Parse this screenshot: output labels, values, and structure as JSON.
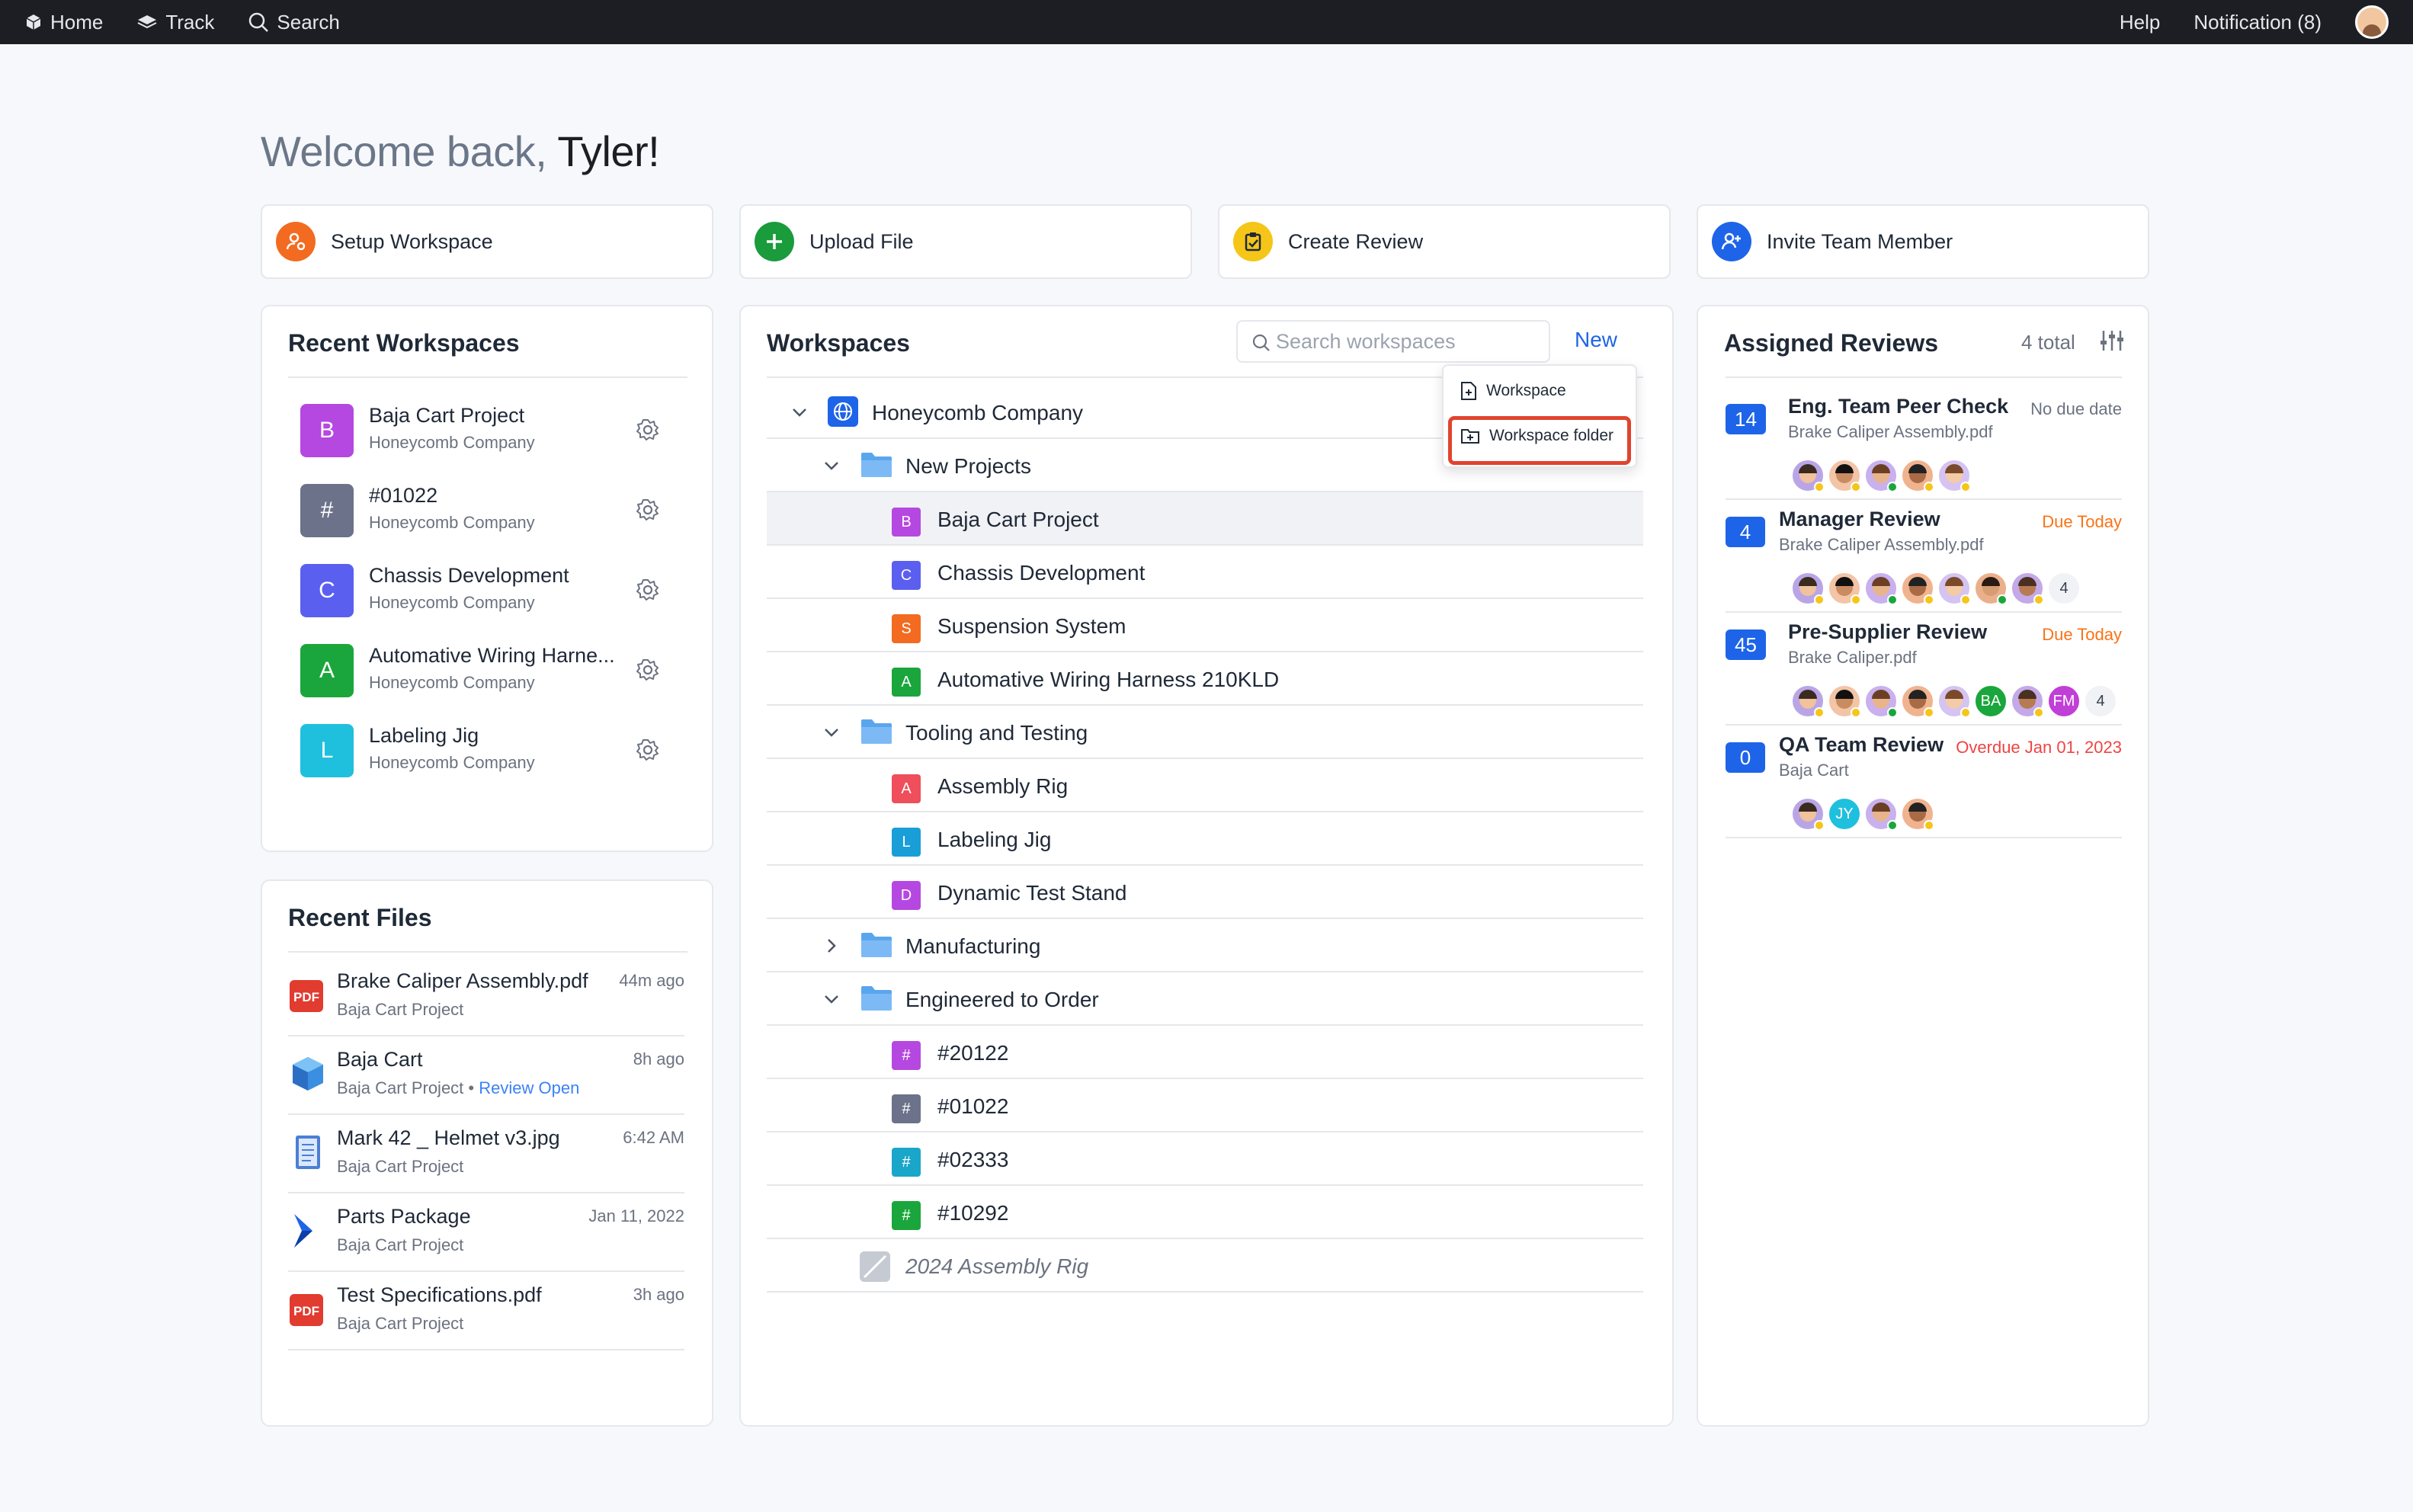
{
  "topbar": {
    "home": "Home",
    "track": "Track",
    "search": "Search",
    "help": "Help",
    "notification": "Notification (8)"
  },
  "welcome": {
    "greeting": "Welcome back,",
    "name": "Tyler!"
  },
  "quick_actions": [
    {
      "label": "Setup Workspace",
      "icon": "user-gear-icon",
      "color": "#f26b21"
    },
    {
      "label": "Upload File",
      "icon": "plus-icon",
      "color": "#1a9b3c"
    },
    {
      "label": "Create Review",
      "icon": "clipboard-check-icon",
      "color": "#f5c518"
    },
    {
      "label": "Invite Team Member",
      "icon": "user-plus-icon",
      "color": "#1e64e8"
    }
  ],
  "recent_workspaces": {
    "title": "Recent Workspaces",
    "items": [
      {
        "badge": "B",
        "name": "Baja Cart Project",
        "company": "Honeycomb Company",
        "color": "#b548e0"
      },
      {
        "badge": "#",
        "name": "#01022",
        "company": "Honeycomb Company",
        "color": "#6b7289"
      },
      {
        "badge": "C",
        "name": "Chassis Development",
        "company": "Honeycomb Company",
        "color": "#5b5ff0"
      },
      {
        "badge": "A",
        "name": "Automative Wiring Harne...",
        "company": "Honeycomb Company",
        "color": "#1aa63c"
      },
      {
        "badge": "L",
        "name": "Labeling Jig",
        "company": "Honeycomb Company",
        "color": "#1fc0dd"
      }
    ]
  },
  "recent_files": {
    "title": "Recent Files",
    "items": [
      {
        "name": "Brake Caliper Assembly.pdf",
        "project": "Baja Cart Project",
        "time": "44m ago",
        "icon": "pdf-icon",
        "link": ""
      },
      {
        "name": "Baja Cart",
        "project": "Baja Cart Project",
        "time": "8h ago",
        "icon": "cube-icon",
        "link": "Review Open"
      },
      {
        "name": "Mark 42 _ Helmet v3.jpg",
        "project": "Baja Cart Project",
        "time": "6:42 AM",
        "icon": "document-icon",
        "link": ""
      },
      {
        "name": "Parts Package",
        "project": "Baja Cart Project",
        "time": "Jan 11, 2022",
        "icon": "chevron-logo-icon",
        "link": ""
      },
      {
        "name": "Test Specifications.pdf",
        "project": "Baja Cart Project",
        "time": "3h ago",
        "icon": "pdf-icon",
        "link": ""
      }
    ]
  },
  "workspaces": {
    "title": "Workspaces",
    "search_placeholder": "Search workspaces",
    "new_label": "New",
    "dropdown": [
      "Workspace",
      "Workspace folder"
    ],
    "tree": [
      {
        "label": "Honeycomb Company",
        "type": "root",
        "level": 0,
        "expanded": true
      },
      {
        "label": "New Projects",
        "type": "folder",
        "level": 1,
        "expanded": true
      },
      {
        "label": "Baja Cart Project",
        "type": "ws",
        "level": 2,
        "badge": "B",
        "color": "#b548e0",
        "selected": true
      },
      {
        "label": "Chassis Development",
        "type": "ws",
        "level": 2,
        "badge": "C",
        "color": "#5b5ff0"
      },
      {
        "label": "Suspension System",
        "type": "ws",
        "level": 2,
        "badge": "S",
        "color": "#f26b21"
      },
      {
        "label": "Automative Wiring Harness 210KLD",
        "type": "ws",
        "level": 2,
        "badge": "A",
        "color": "#1aa63c"
      },
      {
        "label": "Tooling and Testing",
        "type": "folder",
        "level": 1,
        "expanded": true
      },
      {
        "label": "Assembly Rig",
        "type": "ws",
        "level": 2,
        "badge": "A",
        "color": "#ef4e5b"
      },
      {
        "label": "Labeling Jig",
        "type": "ws",
        "level": 2,
        "badge": "L",
        "color": "#1a9ed8"
      },
      {
        "label": "Dynamic Test Stand",
        "type": "ws",
        "level": 2,
        "badge": "D",
        "color": "#b548e0"
      },
      {
        "label": "Manufacturing",
        "type": "folder",
        "level": 1,
        "expanded": false
      },
      {
        "label": "Engineered to Order",
        "type": "folder",
        "level": 1,
        "expanded": true
      },
      {
        "label": "#20122",
        "type": "ws",
        "level": 2,
        "badge": "#",
        "color": "#b548e0"
      },
      {
        "label": "#01022",
        "type": "ws",
        "level": 2,
        "badge": "#",
        "color": "#6b7289"
      },
      {
        "label": "#02333",
        "type": "ws",
        "level": 2,
        "badge": "#",
        "color": "#1aa6c8"
      },
      {
        "label": "#10292",
        "type": "ws",
        "level": 2,
        "badge": "#",
        "color": "#1aa63c"
      },
      {
        "label": "2024 Assembly Rig",
        "type": "archived",
        "level": 1
      }
    ]
  },
  "assigned_reviews": {
    "title": "Assigned Reviews",
    "total": "4 total",
    "items": [
      {
        "count": "14",
        "name": "Eng. Team Peer Check",
        "file": "Brake Caliper Assembly.pdf",
        "due": "No due date",
        "due_color": "#6b7280",
        "avatars": [
          "p",
          "p",
          "p",
          "p",
          "p"
        ],
        "extra": ""
      },
      {
        "count": "4",
        "name": "Manager Review",
        "file": "Brake Caliper Assembly.pdf",
        "due": "Due Today",
        "due_color": "#f97316",
        "avatars": [
          "p",
          "p",
          "p",
          "p",
          "p",
          "p",
          "p"
        ],
        "extra": "4"
      },
      {
        "count": "45",
        "name": "Pre-Supplier Review",
        "file": "Brake Caliper.pdf",
        "due": "Due Today",
        "due_color": "#f97316",
        "avatars": [
          "p",
          "p",
          "p",
          "p",
          "p",
          "BA",
          "p",
          "FM"
        ],
        "extra": "4"
      },
      {
        "count": "0",
        "name": "QA Team Review",
        "file": "Baja Cart",
        "due": "Overdue Jan 01, 2023",
        "due_color": "#ef4444",
        "avatars": [
          "p",
          "JY",
          "p",
          "p"
        ],
        "extra": ""
      }
    ]
  }
}
